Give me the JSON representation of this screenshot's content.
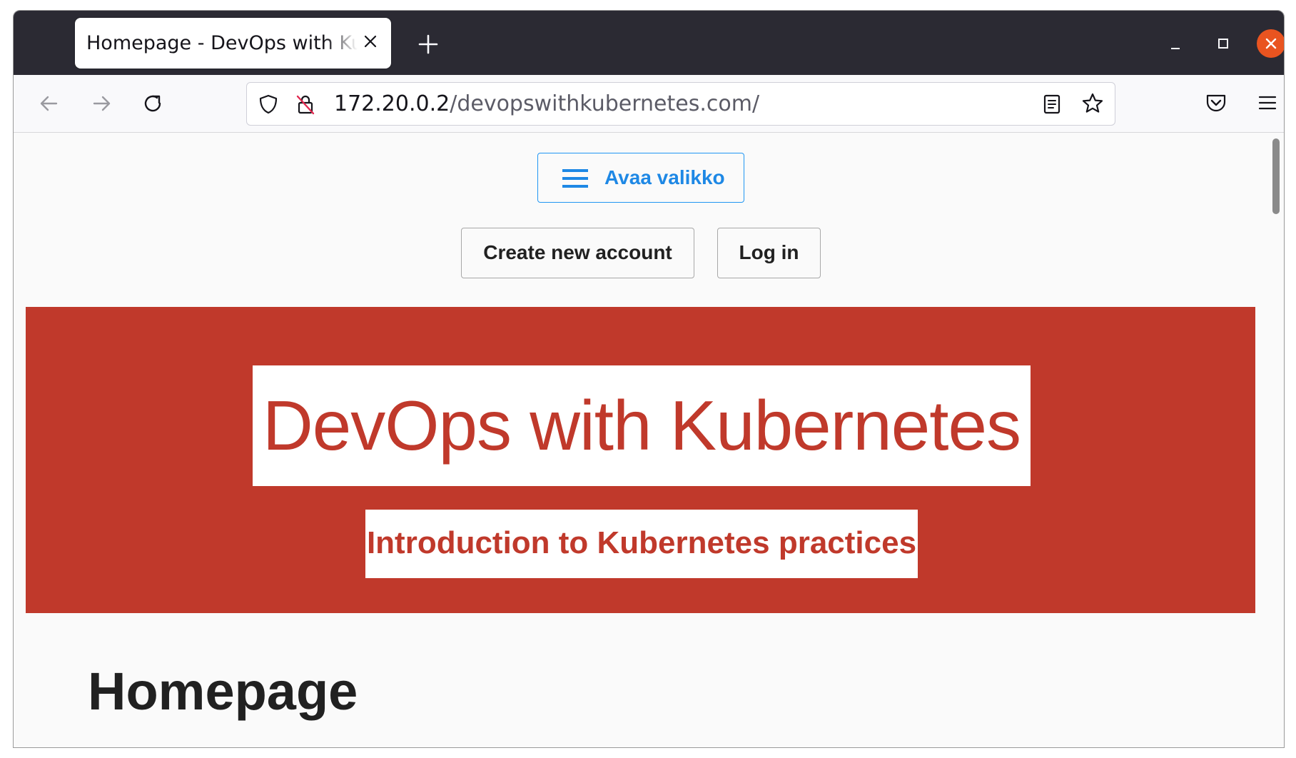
{
  "browser": {
    "tab": {
      "title": "Homepage - DevOps with Kubernetes"
    },
    "url": {
      "host": "172.20.0.2",
      "path": "/devopswithkubernetes.com/"
    },
    "icons": {
      "tab_close": "close-icon",
      "new_tab": "plus-icon",
      "minimize": "minimize-icon",
      "maximize": "maximize-icon",
      "close": "close-icon",
      "back": "arrow-left-icon",
      "forward": "arrow-right-icon",
      "reload": "reload-icon",
      "shield": "shield-icon",
      "insecure_lock": "insecure-lock-icon",
      "reader": "reader-view-icon",
      "bookmark": "star-icon",
      "pocket": "pocket-icon",
      "menu": "hamburger-menu-icon"
    },
    "colors": {
      "titlebar": "#2b2a33",
      "close_button": "#e95420"
    }
  },
  "page": {
    "menu_button_label": "Avaa valikko",
    "create_account_label": "Create new account",
    "login_label": "Log in",
    "hero_title": "DevOps with Kubernetes",
    "hero_subtitle": "Introduction to Kubernetes practices",
    "heading": "Homepage",
    "colors": {
      "hero_background": "#c0392b",
      "accent_blue": "#1e88e5"
    }
  }
}
